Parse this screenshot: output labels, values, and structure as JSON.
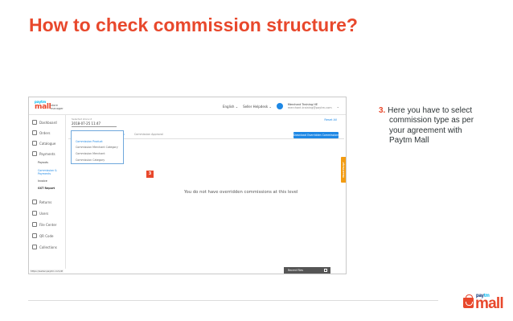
{
  "slide": {
    "title": "How to check commission structure?",
    "step_number": "3.",
    "step_lines": [
      "Here you have to select",
      "commission type as per",
      "your agreement with",
      "Paytm Mall"
    ]
  },
  "brand": {
    "paytm_pay": "pay",
    "paytm_tm": "tm",
    "mall": "mall",
    "color": "#e8482c"
  },
  "app": {
    "logo": {
      "paytm": "paytm",
      "mall": "mall",
      "sub": "store manager"
    },
    "topbar": {
      "language": "English",
      "helpdesk": "Seller Helpdesk",
      "merchant_name": "Merchant Training HE",
      "merchant_email": "merchant.training@paytm.com"
    },
    "sidebar": {
      "items": [
        {
          "label": "Dashboard",
          "icon": "dashboard-icon"
        },
        {
          "label": "Orders",
          "icon": "orders-icon"
        },
        {
          "label": "Catalogue",
          "icon": "catalogue-icon"
        },
        {
          "label": "Payments",
          "icon": "payments-icon"
        },
        {
          "label": "Returns",
          "icon": "returns-icon"
        },
        {
          "label": "Users",
          "icon": "users-icon"
        },
        {
          "label": "File Center",
          "icon": "file-icon"
        },
        {
          "label": "QR Code",
          "icon": "qr-icon"
        },
        {
          "label": "Collections",
          "icon": "collections-icon"
        }
      ],
      "payment_sub": [
        "Payouts",
        "Commission &",
        "Payments",
        "Invoice",
        "GST Report"
      ]
    },
    "store": {
      "label": "Selected store id",
      "value": "2018-07-25 11:47",
      "reset": "Reset All"
    },
    "tabs": {
      "active": "Commission Commission Overridden",
      "other": "Commission Approval"
    },
    "download_label": "Download Overridden Commissions",
    "dropdown_options": [
      "Commission Product",
      "Commission Merchant Category",
      "Commission Merchant",
      "Commission Category"
    ],
    "badge": "3",
    "empty_message": "You do not have overridden commissions at this level",
    "need_help": "Need Help?",
    "status_url": "https://seller.paytm.com/#",
    "recent_files": "Recent Files"
  }
}
